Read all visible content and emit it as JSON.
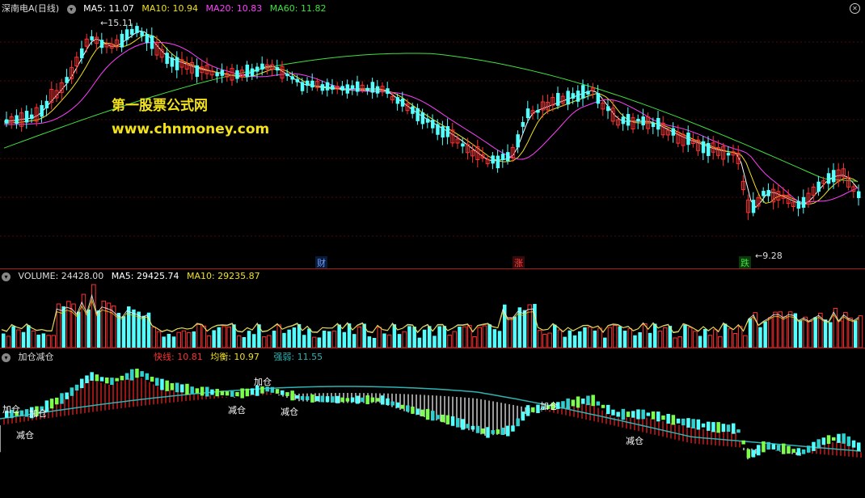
{
  "main": {
    "title": "深南电A(日线)",
    "ma5": "MA5: 11.07",
    "ma10": "MA10: 10.94",
    "ma20": "MA20: 10.83",
    "ma60": "MA60: 11.82",
    "high_label": "15.11",
    "low_label": "9.28",
    "watermark_cn": "第一股票公式网",
    "watermark_url": "www.chnmoney.com",
    "events": [
      "财",
      "涨",
      "跌"
    ]
  },
  "volume": {
    "vol": "VOLUME: 24428.00",
    "ma5": "MA5: 29425.74",
    "ma10": "MA10: 29235.87"
  },
  "indicator": {
    "name": "加仓减仓",
    "fast": "快线: 10.81",
    "balance": "均衡: 10.97",
    "strength": "强弱: 11.55",
    "signals": [
      "加仓",
      "减仓",
      "加仓",
      "减仓",
      "加仓",
      "减仓",
      "加仓",
      "减仓"
    ]
  },
  "colors": {
    "up": "#ff3232",
    "down": "#54ffff",
    "ma5": "#ffffff",
    "ma10": "#f0e020",
    "ma20": "#ff40ff",
    "ma60": "#40e040",
    "balance_line": "#2fb3b3",
    "green_candle": "#7CFF4C"
  }
}
